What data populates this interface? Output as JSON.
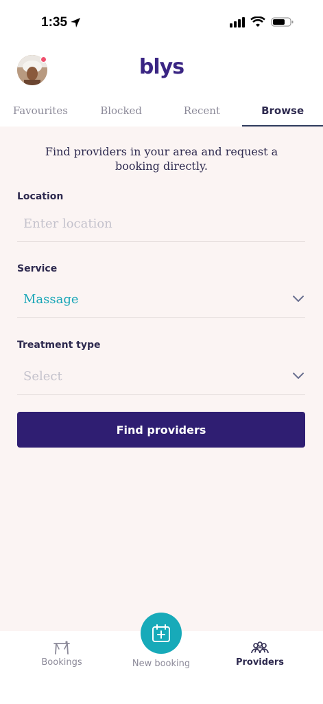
{
  "status_bar": {
    "time": "1:35"
  },
  "header": {
    "logo": "blys"
  },
  "tabs": [
    {
      "label": "Favourites",
      "active": false
    },
    {
      "label": "Blocked",
      "active": false
    },
    {
      "label": "Recent",
      "active": false
    },
    {
      "label": "Browse",
      "active": true
    }
  ],
  "main": {
    "intro": "Find providers in your area and request a booking directly.",
    "location": {
      "label": "Location",
      "placeholder": "Enter location",
      "value": ""
    },
    "service": {
      "label": "Service",
      "value": "Massage"
    },
    "treatment": {
      "label": "Treatment type",
      "placeholder": "Select"
    },
    "find_button": "Find providers"
  },
  "bottom_nav": {
    "bookings": "Bookings",
    "new_booking": "New booking",
    "providers": "Providers"
  },
  "colors": {
    "brand": "#2f1e72",
    "accent": "#17aab9",
    "background": "#fbf4f3"
  }
}
